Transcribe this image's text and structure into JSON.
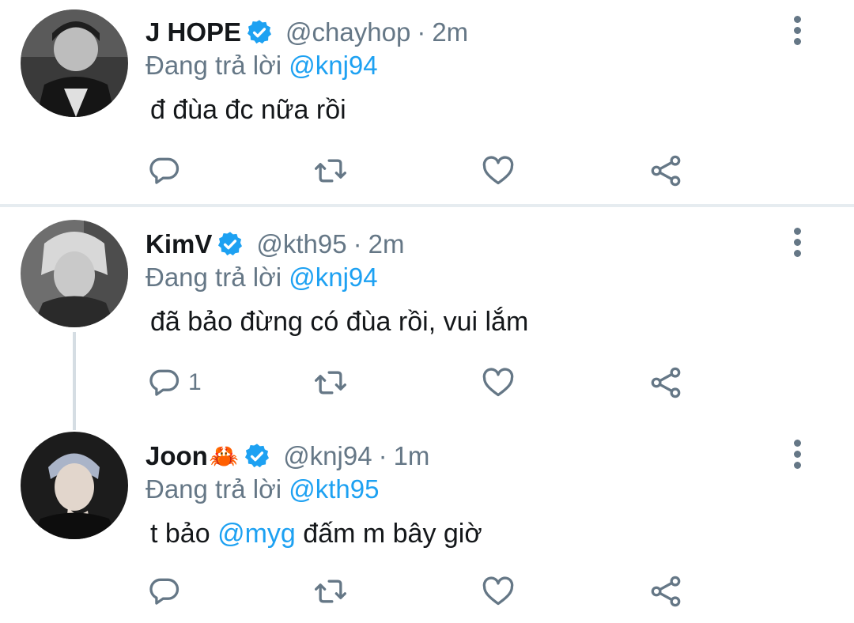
{
  "colors": {
    "accent": "#1da1f2",
    "muted": "#657786",
    "text": "#14171a",
    "divider": "#e6ecf0"
  },
  "tweets": [
    {
      "name": "J HOPE",
      "handle": "@chayhop",
      "separator": "·",
      "time": "2m",
      "reply_prefix": "Đang trả lời",
      "reply_to": "@knj94",
      "text": "đ đùa đc nữa rồi",
      "reply_count": ""
    },
    {
      "name": "KimV",
      "handle": "@kth95",
      "separator": "·",
      "time": "2m",
      "reply_prefix": "Đang trả lời",
      "reply_to": "@knj94",
      "text": "đã bảo đừng có đùa rồi, vui lắm",
      "reply_count": "1"
    },
    {
      "name": "Joon",
      "name_emoji": "🦀",
      "handle": "@knj94",
      "separator": "·",
      "time": "1m",
      "reply_prefix": "Đang trả lời",
      "reply_to": "@kth95",
      "text_before": "t bảo",
      "text_mention": "@myg",
      "text_after": "đấm m bây giờ",
      "reply_count": ""
    }
  ],
  "icons": [
    "verified-badge-icon",
    "more-vertical-icon",
    "reply-icon",
    "retweet-icon",
    "like-icon",
    "share-icon"
  ]
}
